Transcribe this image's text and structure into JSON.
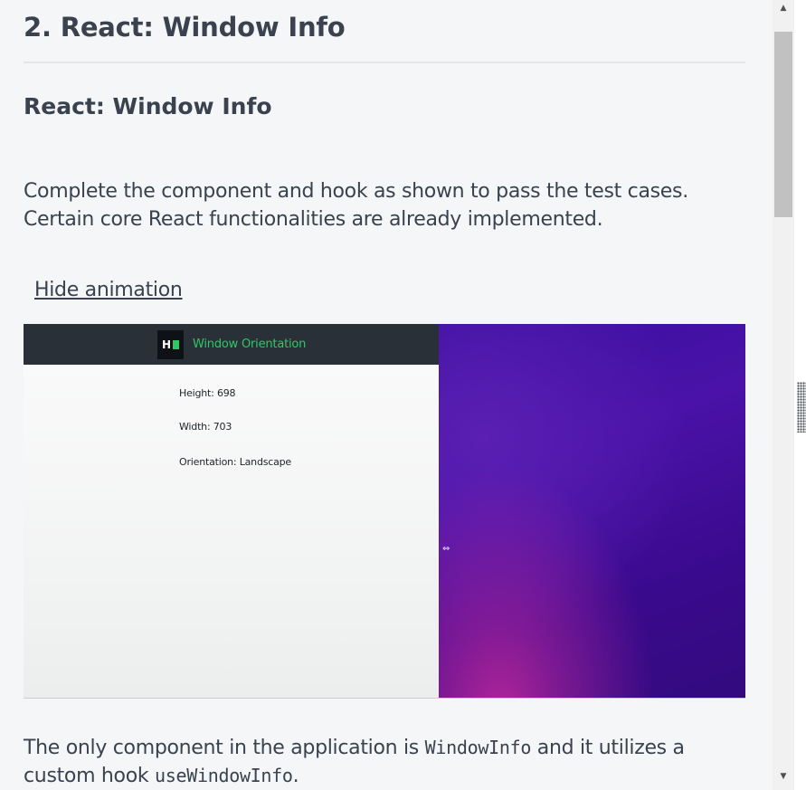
{
  "header": {
    "title": "2. React: Window Info"
  },
  "section": {
    "heading": "React: Window Info",
    "intro": "Complete the component and hook as shown to pass the test cases. Certain core React functionalities are already implemented.",
    "toggle_animation_label": "Hide animation"
  },
  "demo": {
    "app_title": "Window Orientation",
    "logo_letter": "H",
    "height_line": "Height: 698",
    "width_line": "Width: 703",
    "orientation_line": "Orientation: Landscape",
    "resize_cursor_glyph": "⇔",
    "colors": {
      "navbar": "#2a3038",
      "accent": "#2ec866",
      "desktop": "#3a0fa0"
    }
  },
  "footer_paragraph": {
    "text_before": "The only component in the application is ",
    "code_component": "WindowInfo",
    "text_middle": " and it utilizes a custom hook ",
    "code_hook": "useWindowInfo",
    "text_after": "."
  },
  "scrollbar": {
    "up_arrow": "▲",
    "down_arrow": "▼"
  }
}
